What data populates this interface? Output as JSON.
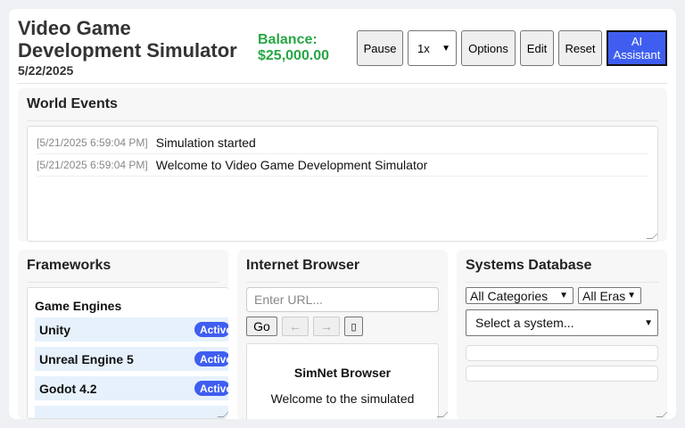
{
  "header": {
    "title_line1": "Video Game",
    "title_line2": "Development Simulator",
    "date": "5/22/2025",
    "balance_label": "Balance:",
    "balance_value": "$25,000.00"
  },
  "toolbar": {
    "pause": "Pause",
    "speed": "1x",
    "options": "Options",
    "edit": "Edit",
    "reset": "Reset",
    "ai_line1": "AI",
    "ai_line2": "Assistant"
  },
  "world_events": {
    "title": "World Events",
    "events": [
      {
        "time": "[5/21/2025 6:59:04 PM]",
        "message": "Simulation started"
      },
      {
        "time": "[5/21/2025 6:59:04 PM]",
        "message": "Welcome to Video Game Development Simulator"
      }
    ]
  },
  "frameworks": {
    "title": "Frameworks",
    "category": "Game Engines",
    "items": [
      {
        "name": "Unity",
        "status": "Active"
      },
      {
        "name": "Unreal Engine 5",
        "status": "Active"
      },
      {
        "name": "Godot 4.2",
        "status": "Active"
      }
    ]
  },
  "browser": {
    "title": "Internet Browser",
    "url_placeholder": "Enter URL...",
    "go": "Go",
    "back": "←",
    "forward": "→",
    "bookmark": "▯",
    "page_title": "SimNet Browser",
    "page_text": "Welcome to the simulated"
  },
  "systems": {
    "title": "Systems Database",
    "category": "All Categories",
    "era": "All Eras",
    "system": "Select a system..."
  },
  "colors": {
    "accent": "#3f5ef0",
    "balance": "#28a745"
  }
}
